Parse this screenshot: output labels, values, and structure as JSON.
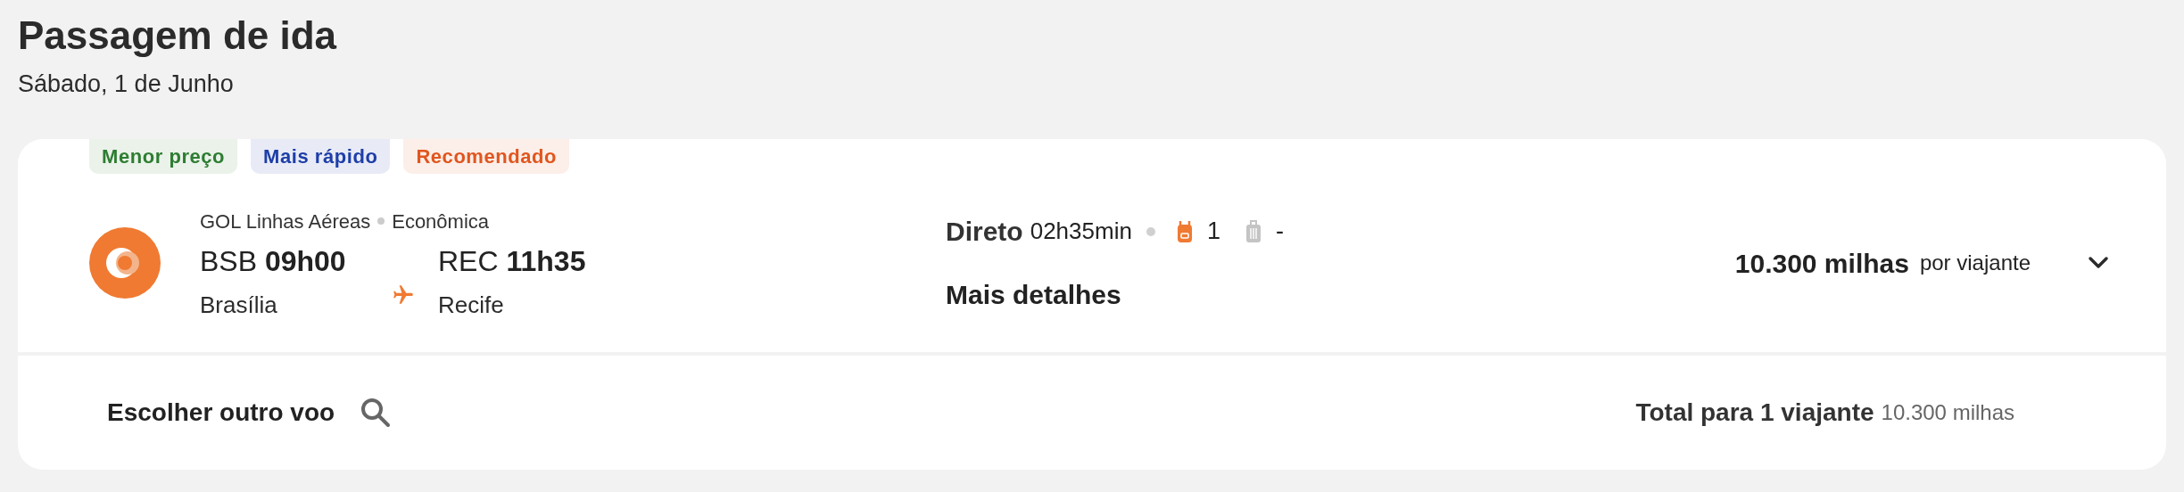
{
  "header": {
    "title": "Passagem de ida",
    "date": "Sábado, 1 de Junho"
  },
  "flight": {
    "tags": [
      {
        "label": "Menor preço",
        "color": "#2e7d32"
      },
      {
        "label": "Mais rápido",
        "color": "#1e3ea8"
      },
      {
        "label": "Recomendado",
        "color": "#e0561f"
      }
    ],
    "airline": "GOL Linhas Aéreas",
    "cabin": "Econômica",
    "departure": {
      "code": "BSB",
      "time": "09h00",
      "city": "Brasília"
    },
    "arrival": {
      "code": "REC",
      "time": "11h35",
      "city": "Recife"
    },
    "stops": "Direto",
    "duration": "02h35min",
    "bags": [
      {
        "kind": "backpack",
        "included": true,
        "count": "1"
      },
      {
        "kind": "suitcase",
        "included": false,
        "count": "-"
      }
    ],
    "details_link": "Mais detalhes",
    "price": "10.300 milhas",
    "price_note": "por viajante",
    "expanded": false
  },
  "footer": {
    "change_link": "Escolher outro voo",
    "total_label": "Total para 1 viajante",
    "total_value": "10.300 milhas"
  }
}
